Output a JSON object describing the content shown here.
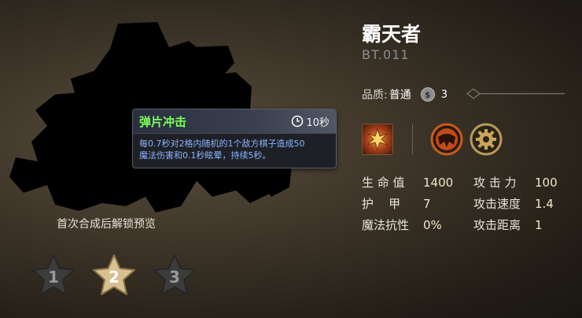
{
  "preview": {
    "unlock_text": "首次合成后解锁预览"
  },
  "skill": {
    "name": "弹片冲击",
    "cooldown": "10秒",
    "description_line1": "每0.7秒对2格内随机的1个敌方棋子造成50",
    "description_line2": "魔法伤害和0.1秒眩晕，持续5秒。"
  },
  "hero": {
    "name": "霸天者",
    "code": "BT.011"
  },
  "quality": {
    "label": "品质:",
    "value": "普通",
    "coin_symbol": "$",
    "cost": "3"
  },
  "stats": {
    "hp_label": "生 命 值",
    "hp_value": "1400",
    "atk_label": "攻 击 力",
    "atk_value": "100",
    "armor_label": "护    甲",
    "armor_value": "7",
    "atkspeed_label": "攻击速度",
    "atkspeed_value": "1.4",
    "mres_label": "魔法抗性",
    "mres_value": "0%",
    "range_label": "攻击距离",
    "range_value": "1"
  },
  "stars": [
    {
      "label": "1",
      "selected": false
    },
    {
      "label": "2",
      "selected": true
    },
    {
      "label": "3",
      "selected": false
    }
  ],
  "colors": {
    "skill_name": "#7dff5a",
    "skill_desc": "#8ab4ff",
    "star_selected": "#d9c090"
  }
}
